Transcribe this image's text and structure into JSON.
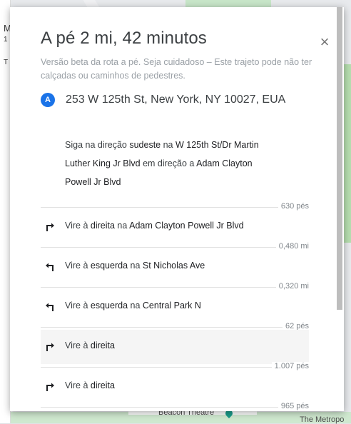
{
  "dialog": {
    "title": "A pé 2 mi, 42 minutos",
    "close_label": "×",
    "beta_note": "Versão beta da rota a pé. Seja cuidadoso – Este trajeto pode não ter calçadas ou caminhos de pedestres.",
    "origin_badge": "A",
    "origin_address": "253 W 125th St, New York, NY 10027, EUA"
  },
  "first_step": {
    "part1": "Siga na direção ",
    "part2": "sudeste",
    "part3": " na ",
    "part4": "W 125th St/Dr Martin Luther King Jr Blvd",
    "part5": " em direção a ",
    "part6": "Adam Clayton Powell Jr Blvd",
    "distance": "630 pés"
  },
  "steps": [
    {
      "action": "Vire à ",
      "dir": "direita",
      "mid": " na ",
      "street": "Adam Clayton Powell Jr Blvd",
      "icon": "turn-right-icon",
      "distance": "0,480 mi"
    },
    {
      "action": "Vire à ",
      "dir": "esquerda",
      "mid": " na ",
      "street": "St Nicholas Ave",
      "icon": "turn-left-icon",
      "distance": "0,320 mi"
    },
    {
      "action": "Vire à ",
      "dir": "esquerda",
      "mid": " na ",
      "street": "Central Park N",
      "icon": "turn-left-icon",
      "distance": "62 pés"
    },
    {
      "action": "Vire à ",
      "dir": "direita",
      "mid": "",
      "street": "",
      "icon": "turn-right-icon",
      "distance": "1.007 pés"
    },
    {
      "action": "Vire à ",
      "dir": "direita",
      "mid": "",
      "street": "",
      "icon": "turn-right-icon",
      "distance": "965 pés"
    }
  ],
  "map": {
    "label_beacon": "Beacon Theatre",
    "label_metro": "The Metropo"
  },
  "left_panel": {
    "frag1": "M",
    "frag2": "1",
    "frag3": "T"
  },
  "colors": {
    "accent": "#1a73e8",
    "text": "#3c4043",
    "muted": "#9aa0a6"
  }
}
